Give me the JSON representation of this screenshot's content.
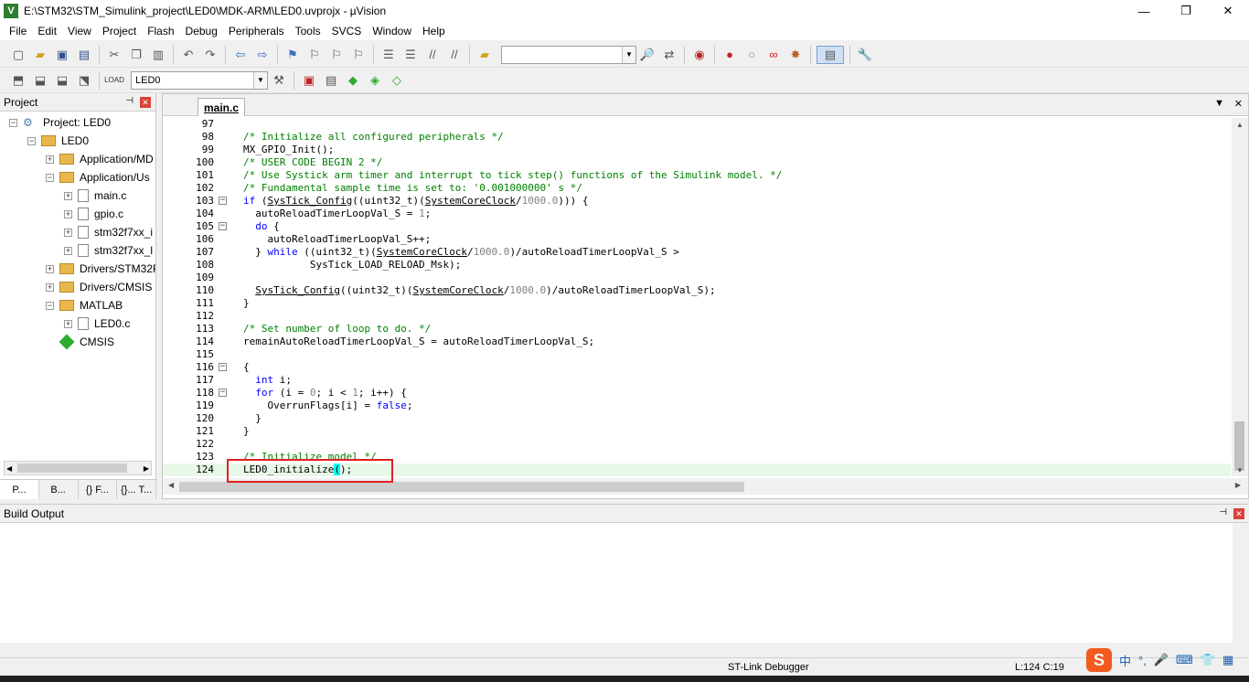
{
  "window": {
    "title": "E:\\STM32\\STM_Simulink_project\\LED0\\MDK-ARM\\LED0.uvprojx - µVision",
    "minimize": "—",
    "restore": "❐",
    "close": "✕"
  },
  "menu": [
    "File",
    "Edit",
    "View",
    "Project",
    "Flash",
    "Debug",
    "Peripherals",
    "Tools",
    "SVCS",
    "Window",
    "Help"
  ],
  "toolbar2": {
    "target": "LED0"
  },
  "project_panel": {
    "title": "Project",
    "tree": [
      {
        "label": "Project: LED0",
        "level": 0,
        "icon": "project-icon",
        "expander": "−"
      },
      {
        "label": "LED0",
        "level": 1,
        "icon": "folder-icon",
        "expander": "−"
      },
      {
        "label": "Application/MD",
        "level": 2,
        "icon": "folder-icon",
        "expander": "+"
      },
      {
        "label": "Application/Us",
        "level": 2,
        "icon": "folder-icon",
        "expander": "−"
      },
      {
        "label": "main.c",
        "level": 3,
        "icon": "file-icon",
        "expander": "+"
      },
      {
        "label": "gpio.c",
        "level": 3,
        "icon": "file-icon",
        "expander": "+"
      },
      {
        "label": "stm32f7xx_i",
        "level": 3,
        "icon": "file-icon",
        "expander": "+"
      },
      {
        "label": "stm32f7xx_l",
        "level": 3,
        "icon": "file-icon",
        "expander": "+"
      },
      {
        "label": "Drivers/STM32F",
        "level": 2,
        "icon": "folder-icon",
        "expander": "+"
      },
      {
        "label": "Drivers/CMSIS",
        "level": 2,
        "icon": "folder-icon",
        "expander": "+"
      },
      {
        "label": "MATLAB",
        "level": 2,
        "icon": "folder-icon",
        "expander": "−"
      },
      {
        "label": "LED0.c",
        "level": 3,
        "icon": "file-icon",
        "expander": "+"
      },
      {
        "label": "CMSIS",
        "level": 2,
        "icon": "cmsis-icon",
        "expander": ""
      }
    ],
    "tabs": [
      "P...",
      "B...",
      "{} F...",
      "{}... T..."
    ]
  },
  "editor": {
    "tab": "main.c",
    "lines": [
      {
        "n": "97",
        "fold": "",
        "segs": []
      },
      {
        "n": "98",
        "fold": "",
        "segs": [
          {
            "t": "/* Initialize all configured peripherals */",
            "c": "c-cm"
          }
        ]
      },
      {
        "n": "99",
        "fold": "",
        "segs": [
          {
            "t": "MX_GPIO_Init();",
            "c": ""
          }
        ]
      },
      {
        "n": "100",
        "fold": "",
        "segs": [
          {
            "t": "/* USER CODE BEGIN 2 */",
            "c": "c-cm"
          }
        ]
      },
      {
        "n": "101",
        "fold": "",
        "segs": [
          {
            "t": "/* Use Systick arm timer and interrupt to tick step() functions of the Simulink model. */",
            "c": "c-cm"
          }
        ]
      },
      {
        "n": "102",
        "fold": "",
        "segs": [
          {
            "t": "/* Fundamental sample time is set to: '0.001000000' s */",
            "c": "c-cm"
          }
        ]
      },
      {
        "n": "103",
        "fold": "−",
        "segs": [
          {
            "t": "if",
            "c": "c-kw"
          },
          {
            "t": " (",
            "c": ""
          },
          {
            "t": "SysTick_Config",
            "c": "c-ul"
          },
          {
            "t": "((uint32_t)(",
            "c": ""
          },
          {
            "t": "SystemCoreClock",
            "c": "c-ul"
          },
          {
            "t": "/",
            "c": ""
          },
          {
            "t": "1000.0",
            "c": "c-num"
          },
          {
            "t": "))) {",
            "c": ""
          }
        ]
      },
      {
        "n": "104",
        "fold": "",
        "segs": [
          {
            "t": "  autoReloadTimerLoopVal_S = ",
            "c": ""
          },
          {
            "t": "1",
            "c": "c-num"
          },
          {
            "t": ";",
            "c": ""
          }
        ]
      },
      {
        "n": "105",
        "fold": "−",
        "segs": [
          {
            "t": "  ",
            "c": ""
          },
          {
            "t": "do",
            "c": "c-kw"
          },
          {
            "t": " {",
            "c": ""
          }
        ]
      },
      {
        "n": "106",
        "fold": "",
        "segs": [
          {
            "t": "    autoReloadTimerLoopVal_S++;",
            "c": ""
          }
        ]
      },
      {
        "n": "107",
        "fold": "",
        "segs": [
          {
            "t": "  } ",
            "c": ""
          },
          {
            "t": "while",
            "c": "c-kw"
          },
          {
            "t": " ((uint32_t)(",
            "c": ""
          },
          {
            "t": "SystemCoreClock",
            "c": "c-ul"
          },
          {
            "t": "/",
            "c": ""
          },
          {
            "t": "1000.0",
            "c": "c-num"
          },
          {
            "t": ")/autoReloadTimerLoopVal_S >",
            "c": ""
          }
        ]
      },
      {
        "n": "108",
        "fold": "",
        "segs": [
          {
            "t": "           SysTick_LOAD_RELOAD_Msk);",
            "c": ""
          }
        ]
      },
      {
        "n": "109",
        "fold": "",
        "segs": []
      },
      {
        "n": "110",
        "fold": "",
        "segs": [
          {
            "t": "  ",
            "c": ""
          },
          {
            "t": "SysTick_Config",
            "c": "c-ul"
          },
          {
            "t": "((uint32_t)(",
            "c": ""
          },
          {
            "t": "SystemCoreClock",
            "c": "c-ul"
          },
          {
            "t": "/",
            "c": ""
          },
          {
            "t": "1000.0",
            "c": "c-num"
          },
          {
            "t": ")/autoReloadTimerLoopVal_S);",
            "c": ""
          }
        ]
      },
      {
        "n": "111",
        "fold": "",
        "segs": [
          {
            "t": "}",
            "c": ""
          }
        ]
      },
      {
        "n": "112",
        "fold": "",
        "segs": []
      },
      {
        "n": "113",
        "fold": "",
        "segs": [
          {
            "t": "/* Set number of loop to do. */",
            "c": "c-cm"
          }
        ]
      },
      {
        "n": "114",
        "fold": "",
        "segs": [
          {
            "t": "remainAutoReloadTimerLoopVal_S = autoReloadTimerLoopVal_S;",
            "c": ""
          }
        ]
      },
      {
        "n": "115",
        "fold": "",
        "segs": []
      },
      {
        "n": "116",
        "fold": "−",
        "segs": [
          {
            "t": "{",
            "c": ""
          }
        ]
      },
      {
        "n": "117",
        "fold": "",
        "segs": [
          {
            "t": "  ",
            "c": ""
          },
          {
            "t": "int",
            "c": "c-kw"
          },
          {
            "t": " i;",
            "c": ""
          }
        ]
      },
      {
        "n": "118",
        "fold": "−",
        "segs": [
          {
            "t": "  ",
            "c": ""
          },
          {
            "t": "for",
            "c": "c-kw"
          },
          {
            "t": " (i = ",
            "c": ""
          },
          {
            "t": "0",
            "c": "c-num"
          },
          {
            "t": "; i < ",
            "c": ""
          },
          {
            "t": "1",
            "c": "c-num"
          },
          {
            "t": "; i++) {",
            "c": ""
          }
        ]
      },
      {
        "n": "119",
        "fold": "",
        "segs": [
          {
            "t": "    OverrunFlags[i] = ",
            "c": ""
          },
          {
            "t": "false",
            "c": "c-kw"
          },
          {
            "t": ";",
            "c": ""
          }
        ]
      },
      {
        "n": "120",
        "fold": "",
        "segs": [
          {
            "t": "  }",
            "c": ""
          }
        ]
      },
      {
        "n": "121",
        "fold": "",
        "segs": [
          {
            "t": "}",
            "c": ""
          }
        ]
      },
      {
        "n": "122",
        "fold": "",
        "segs": []
      },
      {
        "n": "123",
        "fold": "",
        "segs": [
          {
            "t": "/* Initialize model */",
            "c": "c-cm"
          }
        ]
      },
      {
        "n": "124",
        "fold": "",
        "current": true,
        "segs": [
          {
            "t": "LED0_initialize",
            "c": ""
          },
          {
            "t": "(",
            "c": "c-br"
          },
          {
            "t": ");",
            "c": ""
          }
        ]
      }
    ]
  },
  "build_output": {
    "title": "Build Output"
  },
  "status": {
    "debugger": "ST-Link Debugger",
    "position": "L:124 C:19"
  },
  "ime": {
    "logo": "S",
    "items": [
      "中",
      "°,",
      "🎤",
      "⌨",
      "👕",
      "▦"
    ]
  },
  "colors": {
    "comment": "#008000",
    "keyword": "#0000ff",
    "highlight_box": "#e02020",
    "current_line": "#e8f8e8"
  }
}
